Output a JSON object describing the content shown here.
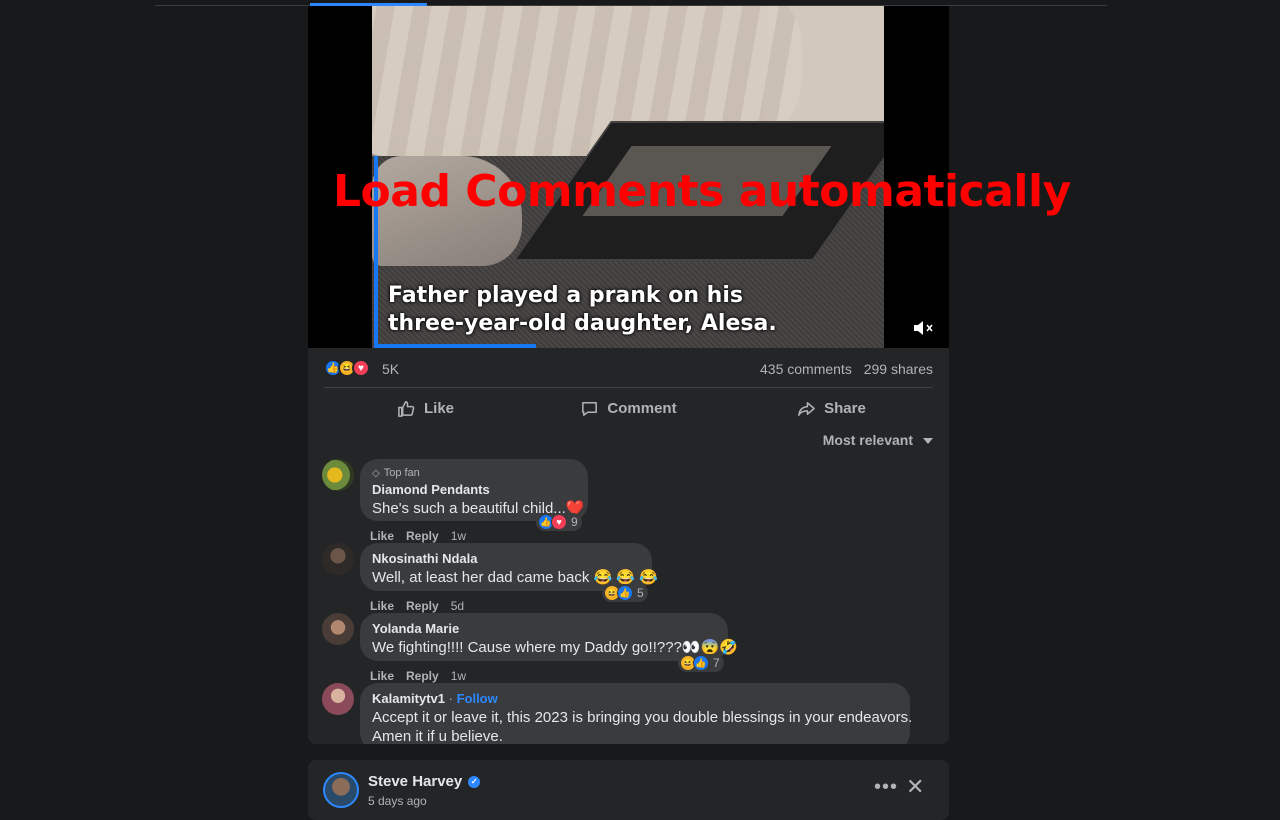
{
  "overlay": {
    "title": "Load Comments automatically"
  },
  "video": {
    "caption_line1": "Father played a prank on his",
    "caption_line2": "three-year-old daughter, Alesa.",
    "mute_icon": "speaker-muted-icon"
  },
  "stats": {
    "reaction_count": "5K",
    "comments": "435 comments",
    "shares": "299 shares"
  },
  "actions": {
    "like": "Like",
    "comment": "Comment",
    "share": "Share"
  },
  "sort": {
    "label": "Most relevant"
  },
  "comments": [
    {
      "badge": "Top fan",
      "name": "Diamond Pendants",
      "text": "She's such a beautiful child...❤️",
      "like": "Like",
      "reply": "Reply",
      "time": "1w",
      "reaction_count": "9"
    },
    {
      "name": "Nkosinathi Ndala",
      "text": "Well, at least her dad came back 😂 😂 😂",
      "like": "Like",
      "reply": "Reply",
      "time": "5d",
      "reaction_count": "5"
    },
    {
      "name": "Yolanda Marie",
      "text": "We fighting!!!! Cause where my Daddy go!!???👀😨🤣",
      "like": "Like",
      "reply": "Reply",
      "time": "1w",
      "reaction_count": "7"
    },
    {
      "name": "Kalamitytv1",
      "follow": "Follow",
      "text_line1": "Accept it or leave it, this 2023 is bringing you double blessings in your endeavors.",
      "text_line2": "Amen it if u believe."
    }
  ],
  "next_post": {
    "author": "Steve Harvey",
    "time": "5 days ago",
    "more_icon": "more-icon",
    "close_icon": "close-icon"
  },
  "colors": {
    "background": "#18191a",
    "card": "#242526",
    "bubble": "#3a3b3c",
    "accent": "#2d88ff",
    "overlay_red": "#ff0000"
  }
}
